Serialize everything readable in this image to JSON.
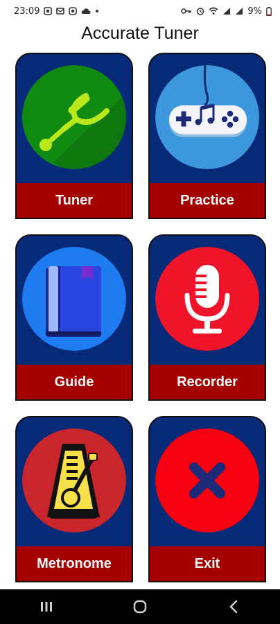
{
  "status_bar": {
    "time": "23:09",
    "battery": "9%"
  },
  "app": {
    "title": "Accurate Tuner"
  },
  "tiles": [
    {
      "label": "Tuner",
      "circle_color": "#118a11",
      "icon": "tuning-fork-icon"
    },
    {
      "label": "Practice",
      "circle_color": "#3c97dc",
      "icon": "gamepad-music-icon"
    },
    {
      "label": "Guide",
      "circle_color": "#1f7cf0",
      "icon": "book-icon"
    },
    {
      "label": "Recorder",
      "circle_color": "#f0142a",
      "icon": "microphone-icon"
    },
    {
      "label": "Metronome",
      "circle_color": "#c8262c",
      "icon": "metronome-icon"
    },
    {
      "label": "Exit",
      "circle_color": "#f70010",
      "icon": "close-icon"
    }
  ],
  "colors": {
    "card_background": "#062a78",
    "label_background": "#a50000",
    "label_text": "#ffffff"
  }
}
